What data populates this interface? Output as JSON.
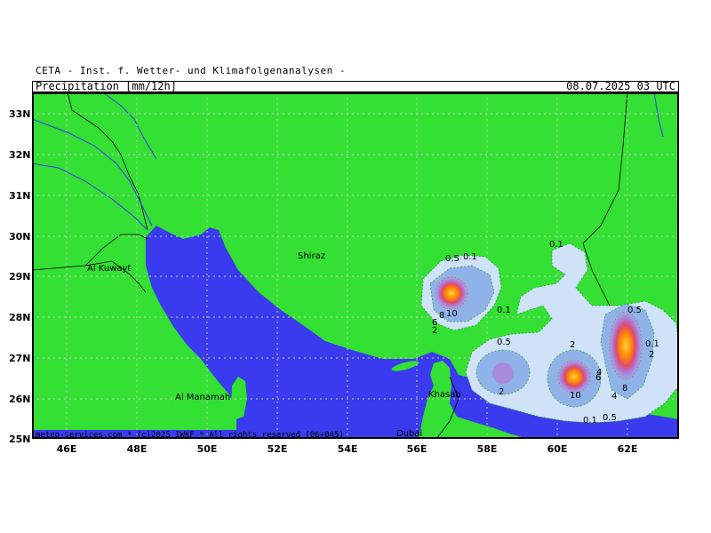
{
  "header": {
    "institute": "CETA - Inst. f. Wetter- und Klimafolgenanalysen -",
    "variable": "Precipitation [mm/12h]",
    "datetime": "08.07.2025 03 UTC"
  },
  "map": {
    "credit": "meteo-services.com * (c)2025 IWKF * All rights reserved (06+045)",
    "latitude_labels": [
      "33N",
      "32N",
      "31N",
      "30N",
      "29N",
      "28N",
      "27N",
      "26N",
      "25N"
    ],
    "longitude_labels": [
      "46E",
      "48E",
      "50E",
      "52E",
      "54E",
      "56E",
      "58E",
      "60E",
      "62E"
    ],
    "cities": [
      "Shiraz",
      "Al Kuwayt",
      "Al Manamah",
      "Khasab",
      "Dubai"
    ],
    "contour_labels": [
      "0.1",
      "0.5",
      "2",
      "6",
      "8",
      "10",
      "4"
    ],
    "colors": {
      "land": "#33e033",
      "sea": "#3a3aee",
      "precip_light": "#cfe2f8",
      "precip_mid": "#8fb3e8",
      "precip_heavy": "#b07ad8",
      "precip_max": "#ff8800"
    }
  }
}
